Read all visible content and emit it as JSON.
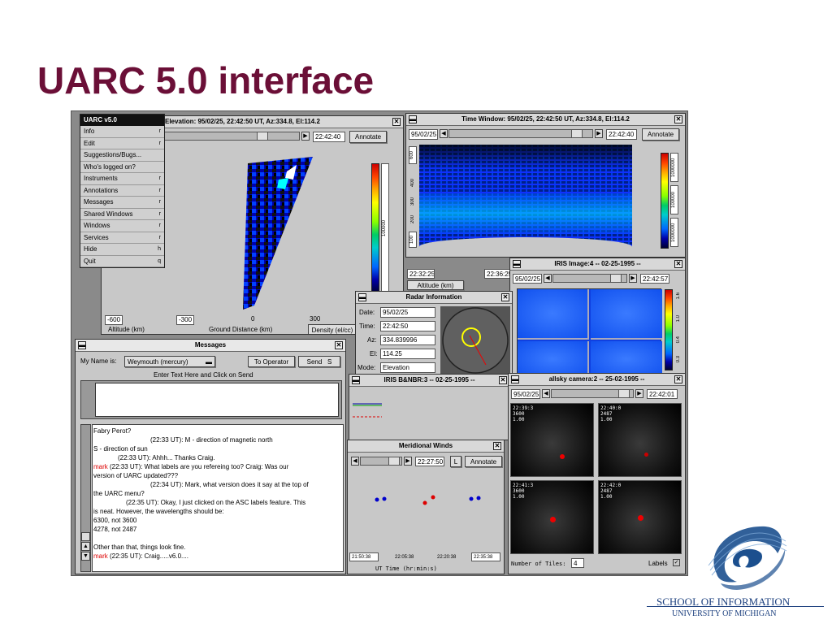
{
  "slide": {
    "title": "UARC 5.0 interface",
    "school": "SCHOOL OF INFORMATION",
    "university": "UNIVERSITY OF MICHIGAN"
  },
  "menu": {
    "header": "UARC v5.0",
    "items": [
      {
        "label": "Info",
        "key": "r"
      },
      {
        "label": "Edit",
        "key": "r"
      },
      {
        "label": "Suggestions/Bugs...",
        "key": ""
      },
      {
        "label": "Who's logged on?",
        "key": ""
      },
      {
        "label": "Instruments",
        "key": "r"
      },
      {
        "label": "Annotations",
        "key": "r"
      },
      {
        "label": "Messages",
        "key": "r"
      },
      {
        "label": "Shared Windows",
        "key": "r"
      },
      {
        "label": "Windows",
        "key": "r"
      },
      {
        "label": "Services",
        "key": "r"
      },
      {
        "label": "Hide",
        "key": "h"
      },
      {
        "label": "Quit",
        "key": "q"
      }
    ]
  },
  "elevation": {
    "title": "Elevation: 95/02/25, 22:42:50 UT, Az:334.8, El:114.2",
    "time": "22:42:40",
    "annotate": "Annotate",
    "ticks": [
      "-600",
      "-300",
      "0",
      "300"
    ],
    "xlabel": "Ground Distance (km)",
    "ylabel": "Altitude (km)",
    "density": "Density (el/cc)"
  },
  "timewin": {
    "title": "Time Window: 95/02/25, 22:42:50 UT, Az:334.8, El:114.2",
    "date": "95/02/25",
    "time": "22:42:40",
    "annotate": "Annotate",
    "y_ticks": [
      "600",
      "400",
      "300",
      "200",
      "100"
    ],
    "t_start": "22:32:25",
    "t_end": "22:36:25",
    "alt": "Altitude (km)",
    "cb_labels": [
      "1000000",
      "100000",
      "1000000"
    ]
  },
  "iris_image": {
    "title": "IRIS Image:4 -- 02-25-1995 --",
    "date": "95/02/25",
    "time": "22:42:57",
    "cb_labels": [
      "1.6",
      "1.0",
      "0.4",
      "0.3"
    ]
  },
  "radar": {
    "title": "Radar Information",
    "date_label": "Date:",
    "date": "95/02/25",
    "time_label": "Time:",
    "time": "22:42:50",
    "az_label": "Az:",
    "az": "334.839996",
    "el_label": "El:",
    "el": "114.25",
    "mode_label": "Mode:",
    "mode": "Elevation"
  },
  "messages": {
    "title": "Messages",
    "name_label": "My Name is:",
    "name": "Weymouth (mercury)",
    "to_operator": "To Operator",
    "send": "Send",
    "send_key": "S",
    "enter_hint": "Enter Text Here and Click on Send",
    "log": [
      {
        "t": "Fabry Perot?",
        "c": "",
        "x": 0
      },
      {
        "t": "(22:33 UT): M - direction of magnetic north",
        "c": "",
        "x": 70
      },
      {
        "t": "S - direction of sun",
        "c": "",
        "x": 0
      },
      {
        "t": "(22:33 UT): Ahhh... Thanks Craig.",
        "c": "",
        "x": 30
      },
      {
        "t": "mark",
        "c": "red",
        "x": 0,
        "rest": "(22:33 UT): What labels are you refereing too? Craig: Was our"
      },
      {
        "t": "version of UARC updated???",
        "c": "",
        "x": 0
      },
      {
        "t": "(22:34 UT): Mark, what version does it say at the top of",
        "c": "",
        "x": 70
      },
      {
        "t": "the UARC menu?",
        "c": "",
        "x": 0
      },
      {
        "t": "(22:35 UT): Okay, I just clicked on the ASC labels feature.  This",
        "c": "",
        "x": 40
      },
      {
        "t": "is neat.  However, the wavelengths should be:",
        "c": "",
        "x": 0
      },
      {
        "t": "6300,   not 3600",
        "c": "",
        "x": 0
      },
      {
        "t": "4278,  not 2487",
        "c": "",
        "x": 0
      },
      {
        "t": "",
        "c": "",
        "x": 0
      },
      {
        "t": "Other than that, things look fine.",
        "c": "",
        "x": 0
      },
      {
        "t": "mark",
        "c": "red",
        "x": 0,
        "rest": "(22:35 UT): Craig.....v6.0...."
      }
    ]
  },
  "irisnbr": {
    "title": "IRIS B&NBR:3 -- 02-25-1995 --"
  },
  "winds": {
    "title": "Meridional Winds",
    "time": "22:27:50",
    "l": "L",
    "annotate": "Annotate",
    "ticks": [
      "21:50:38",
      "22:05:38",
      "22:20:38",
      "22:35:38"
    ],
    "xlabel": "UT Time (hr:min:s)"
  },
  "allsky": {
    "title": "allsky camera:2 -- 25-02-1995 --",
    "date": "95/02/25",
    "time": "22:42:01",
    "tiles": [
      {
        "info": "22:39:3\n3600\n1.00"
      },
      {
        "info": "22:40:0\n2487\n1.00"
      },
      {
        "info": "22:41:3\n3600\n1.00"
      },
      {
        "info": "22:42:0\n2487\n1.00"
      }
    ],
    "tiles_label": "Number of Tiles:",
    "tiles_value": "4",
    "labels": "Labels"
  }
}
